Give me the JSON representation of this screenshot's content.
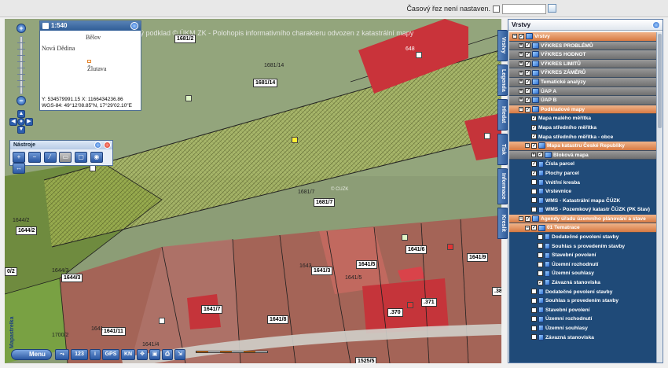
{
  "topbar": {
    "timeslice_label": "Časový řez není nastaven."
  },
  "map": {
    "watermark": "vý podklad © ÚKM ZK - Polohopis informativního charakteru odvozen z katastrální mapy",
    "watermark_small": "© ČÚZK",
    "parcel_labels": [
      "1681/2",
      "1681/14",
      "1681/7",
      "1681/7",
      "1644/2",
      "1644/2",
      "1644/3",
      "1644/3",
      "1641/11",
      "1641/3",
      "1641/5",
      "1641/6",
      "1641/9",
      "1641/7",
      "1641/8",
      ".370",
      ".371",
      ".38",
      "0/2",
      "1641",
      "1641/4",
      "1700/2",
      "1525/5",
      "1641/5",
      "1681/14",
      "1643",
      "648"
    ],
    "scale_label": "Mapastrelka"
  },
  "overview": {
    "title": "1:540",
    "towns": [
      "Bělov",
      "Nová Dědina",
      "Žlutava"
    ],
    "coords_line1": "Y: 534579991.15 X: 1166434236.86",
    "coords_line2": "WGS-84: 49°12'08.85\"N, 17°29'02.10\"E"
  },
  "tools": {
    "title": "Nástroje"
  },
  "bottom_toolbar": {
    "menu_label": "Menu",
    "buttons": [
      "123",
      "GPS",
      "KN"
    ]
  },
  "vtabs": [
    "Vrstvy",
    "Legenda",
    "Hledat",
    "Tisk",
    "Informace",
    "Kreslit"
  ],
  "layers": {
    "title": "Vrstvy",
    "rows": [
      {
        "label": "Vrstvy",
        "level": 0,
        "style": "orange",
        "checked": true
      },
      {
        "label": "VÝKRES PROBLÉMŮ",
        "level": 1,
        "style": "group",
        "checked": true
      },
      {
        "label": "VÝKRES HODNOT",
        "level": 1,
        "style": "group",
        "checked": true
      },
      {
        "label": "VÝKRES LIMITŮ",
        "level": 1,
        "style": "group",
        "checked": true
      },
      {
        "label": "VÝKRES ZÁMĚRŮ",
        "level": 1,
        "style": "group",
        "checked": true
      },
      {
        "label": "Tematické analýzy",
        "level": 1,
        "style": "group",
        "checked": true
      },
      {
        "label": "ÚAP A",
        "level": 1,
        "style": "group",
        "checked": true
      },
      {
        "label": "ÚAP B",
        "level": 1,
        "style": "group",
        "checked": true
      },
      {
        "label": "Podkladové mapy",
        "level": 1,
        "style": "orange",
        "checked": true
      },
      {
        "label": "Mapa malého měřítka",
        "level": 2,
        "style": "plain",
        "checked": true
      },
      {
        "label": "Mapa středního měřítka",
        "level": 2,
        "style": "plain",
        "checked": true
      },
      {
        "label": "Mapa středního měřítka - obce",
        "level": 2,
        "style": "plain",
        "checked": true
      },
      {
        "label": "Mapa katastru České Republiky",
        "level": 2,
        "style": "orange",
        "checked": true
      },
      {
        "label": "Bloková mapa",
        "level": 3,
        "style": "group",
        "checked": true
      },
      {
        "label": "Čísla parcel",
        "level": 2,
        "style": "plain",
        "checked": true
      },
      {
        "label": "Plochy parcel",
        "level": 2,
        "style": "plain",
        "checked": true
      },
      {
        "label": "Vnitřní kresba",
        "level": 2,
        "style": "plain",
        "checked": false
      },
      {
        "label": "Vrstevnice",
        "level": 2,
        "style": "plain",
        "checked": false
      },
      {
        "label": "WMS - Katastrální mapa ČÚZK",
        "level": 2,
        "style": "plain",
        "checked": false
      },
      {
        "label": "WMS - Pozemkový katastr ČÚZK (PK Stav)",
        "level": 2,
        "style": "plain",
        "checked": false
      },
      {
        "label": "Agendy úřadu územního plánování a stave",
        "level": 1,
        "style": "orange",
        "checked": true
      },
      {
        "label": "01 Tematrace",
        "level": 2,
        "style": "orange",
        "checked": true
      },
      {
        "label": "Dodatečné povolení stavby",
        "level": 3,
        "style": "plain",
        "checked": false
      },
      {
        "label": "Souhlas s provedením stavby",
        "level": 3,
        "style": "plain",
        "checked": false
      },
      {
        "label": "Stavební povolení",
        "level": 3,
        "style": "plain",
        "checked": false
      },
      {
        "label": "Územní rozhodnutí",
        "level": 3,
        "style": "plain",
        "checked": false
      },
      {
        "label": "Územní souhlasy",
        "level": 3,
        "style": "plain",
        "checked": false
      },
      {
        "label": "Závazná stanoviska",
        "level": 3,
        "style": "plain",
        "checked": true
      },
      {
        "label": "Dodatečné povolení stavby",
        "level": 2,
        "style": "plain",
        "checked": false
      },
      {
        "label": "Souhlas s provedením stavby",
        "level": 2,
        "style": "plain",
        "checked": false
      },
      {
        "label": "Stavební povolení",
        "level": 2,
        "style": "plain",
        "checked": false
      },
      {
        "label": "Územní rozhodnutí",
        "level": 2,
        "style": "plain",
        "checked": false
      },
      {
        "label": "Územní souhlasy",
        "level": 2,
        "style": "plain",
        "checked": false
      },
      {
        "label": "Závazná stanoviska",
        "level": 2,
        "style": "plain",
        "checked": false
      }
    ]
  }
}
